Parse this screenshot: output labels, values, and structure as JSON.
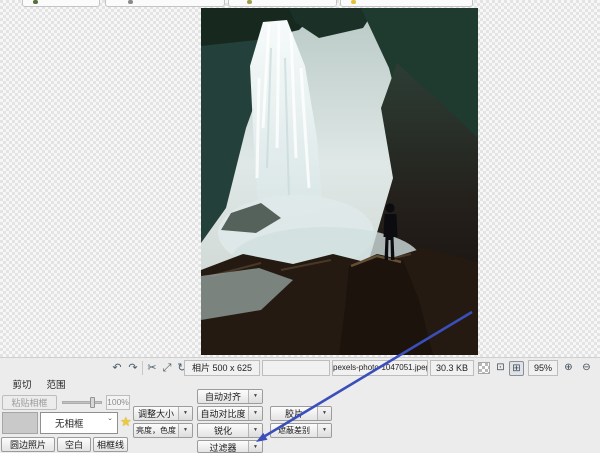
{
  "photo": {
    "description": "Waterfall gorge with a person silhouette standing on a rock"
  },
  "statusbar": {
    "dimensions_label": "相片 500 x 625",
    "filename": "pexels-photo-1047051.jpeg",
    "filesize": "30.3 KB",
    "zoom_level": "95%"
  },
  "icons": {
    "undo": "↶",
    "redo": "↷",
    "crop": "✂",
    "resize": "⤢",
    "rotate": "↻",
    "caret_down": "▼",
    "chevron_down": "ˇ",
    "star": "★",
    "magnifier_actual": "⊡",
    "magnifier_fit": "⊞",
    "zoom_in": "⊕",
    "zoom_out": "⊖"
  },
  "panel": {
    "tabs": [
      {
        "label": "剪切"
      },
      {
        "label": "范围"
      }
    ],
    "paste_frame_label": "粘贴相框",
    "frame_scale_value": "100%",
    "frame_select_value": "无相框",
    "bottom_buttons": {
      "round_edge": "圆边照片",
      "blank": "空白",
      "frame_line": "相框线"
    },
    "edit_buttons": {
      "auto_align": "自动对齐",
      "resize": "调整大小",
      "auto_contrast": "自动对比度",
      "film": "胶片",
      "brightness": "亮度，色度",
      "sharpen": "锐化",
      "mask_diff": "遮蔽差别",
      "filter": "过滤器"
    }
  },
  "colors": {
    "arrow": "#3a4fba",
    "star": "#eec93e"
  }
}
